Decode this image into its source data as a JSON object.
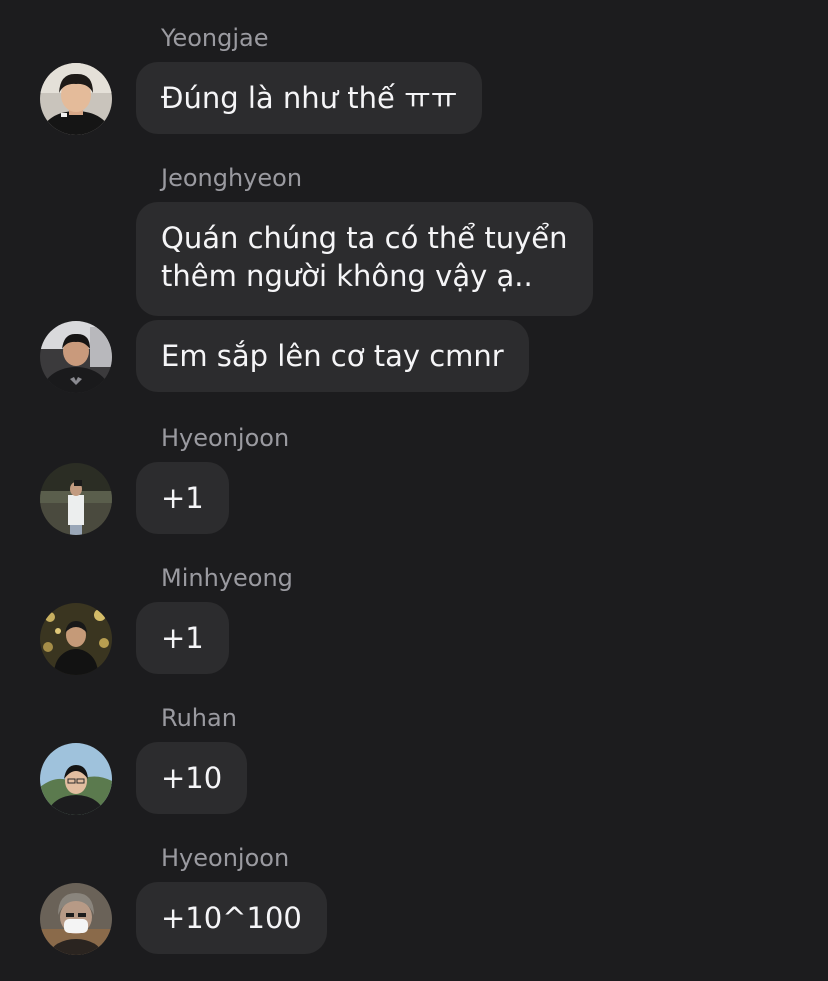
{
  "messages": [
    {
      "sender": "Yeongjae",
      "lines": [
        "Đúng là như thế ㅠㅠ"
      ]
    },
    {
      "sender": "Jeonghyeon",
      "lines": [
        "Quán chúng ta có thể tuyển",
        "thêm người không vậy ạ.."
      ]
    },
    {
      "sender": "",
      "lines": [
        "Em sắp lên cơ tay cmnr"
      ]
    },
    {
      "sender": "Hyeonjoon",
      "lines": [
        "+1"
      ]
    },
    {
      "sender": "Minhyeong",
      "lines": [
        "+1"
      ]
    },
    {
      "sender": "Ruhan",
      "lines": [
        "+10"
      ]
    },
    {
      "sender": "Hyeonjoon",
      "lines": [
        "+10^100"
      ]
    }
  ],
  "colors": {
    "background": "#1c1c1e",
    "bubble": "#2c2c2e",
    "sender_name": "#9a9aa0",
    "message_text": "#f5f5f7"
  }
}
